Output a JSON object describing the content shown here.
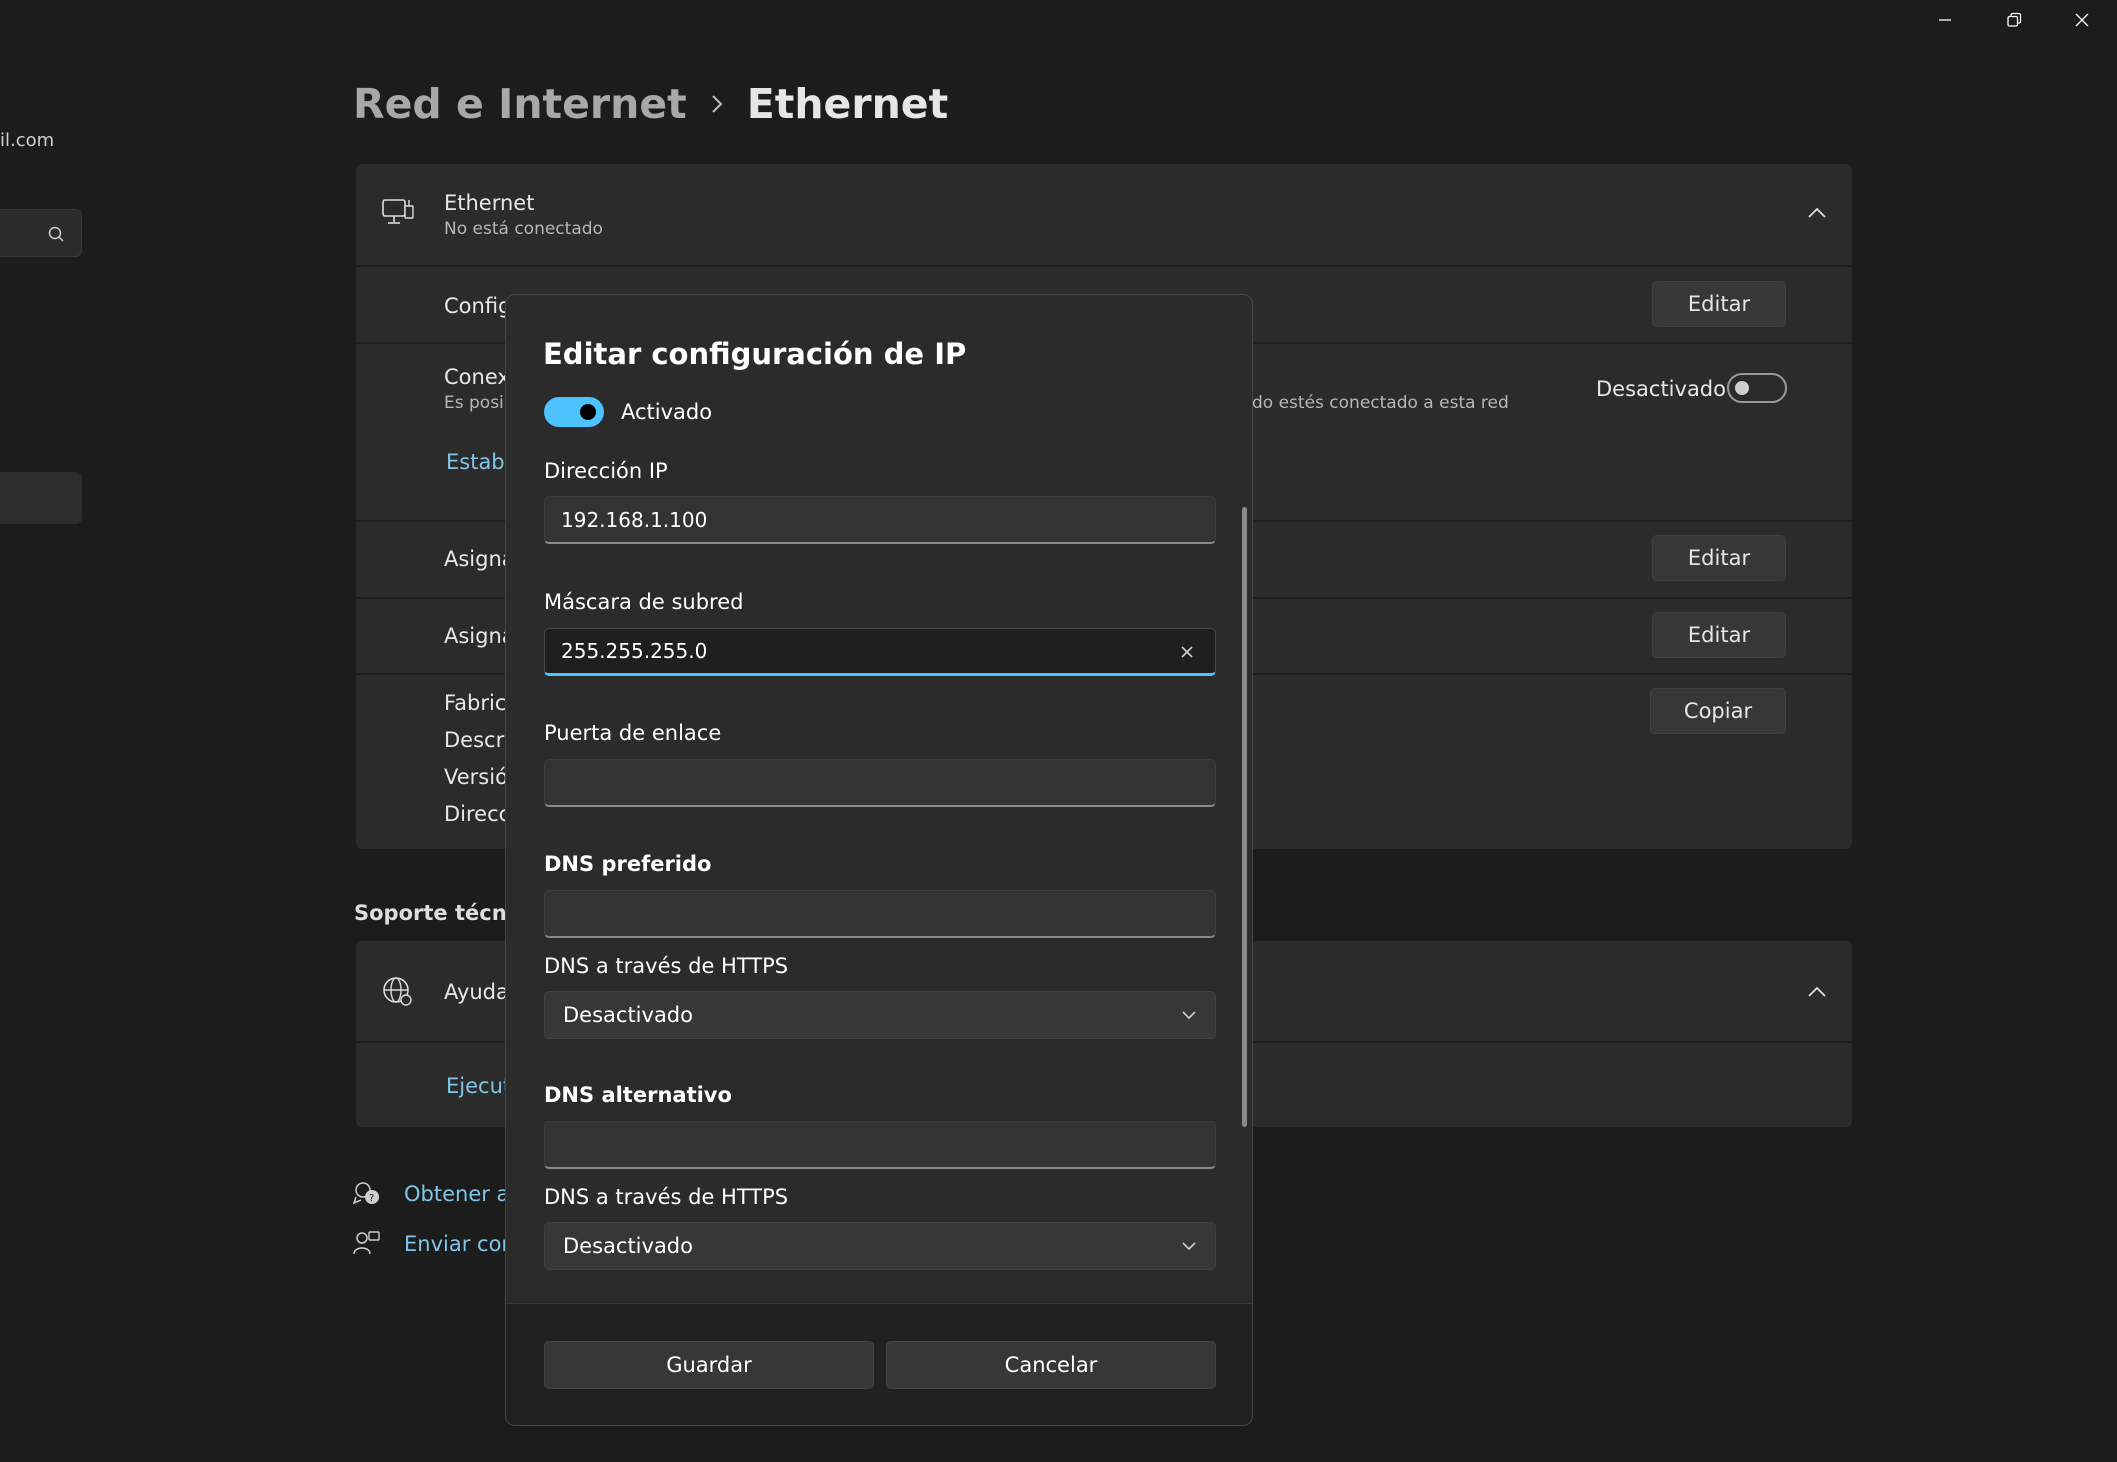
{
  "window": {
    "minimize_icon": "minimize-icon",
    "maximize_icon": "restore-icon",
    "close_icon": "close-icon"
  },
  "sidebar": {
    "account_email_fragment": "il.com",
    "search_icon": "search-icon"
  },
  "breadcrumb": {
    "parent": "Red e Internet",
    "separator": "›",
    "current": "Ethernet"
  },
  "ethernet_card": {
    "title": "Ethernet",
    "status": "No está conectado",
    "rows": {
      "config_label": "Config",
      "connection_label": "Conexi",
      "connection_sub": "Es posib",
      "connection_sub_right": "do estés conectado a esta red",
      "metered_toggle_label": "Desactivado",
      "link_label": "Estable",
      "assign1_label": "Asigna",
      "assign2_label": "Asigna",
      "props": [
        "Fabrica",
        "Descrip",
        "Versión",
        "Direcci"
      ]
    },
    "buttons": {
      "edit1": "Editar",
      "edit2": "Editar",
      "edit3": "Editar",
      "copy": "Copiar"
    }
  },
  "support": {
    "section_title": "Soporte técnico",
    "help_label": "Ayuda",
    "run_link": "Ejecuta",
    "get_help": "Obtener ay",
    "send_feedback": "Enviar com"
  },
  "dialog": {
    "title": "Editar configuración de IP",
    "toggle_label": "Activado",
    "toggle_on": true,
    "ip_label": "Dirección IP",
    "ip_value": "192.168.1.100",
    "mask_label": "Máscara de subred",
    "mask_value": "255.255.255.0",
    "gateway_label": "Puerta de enlace",
    "gateway_value": "",
    "dns_pref_label": "DNS preferido",
    "dns_pref_value": "",
    "dns_https1_label": "DNS a través de HTTPS",
    "dns_https1_value": "Desactivado",
    "dns_alt_label": "DNS alternativo",
    "dns_alt_value": "",
    "dns_https2_label": "DNS a través de HTTPS",
    "dns_https2_value": "Desactivado",
    "save_label": "Guardar",
    "cancel_label": "Cancelar"
  },
  "colors": {
    "accent": "#4cc2ff",
    "link": "#7fc6e8",
    "background": "#1c1c1c",
    "card": "#2b2b2b"
  }
}
